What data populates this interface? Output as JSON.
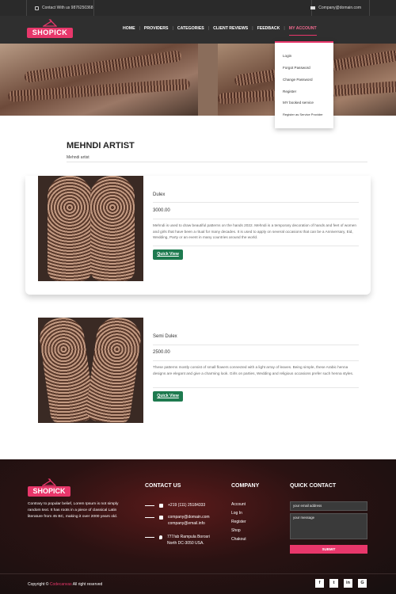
{
  "topbar": {
    "contact_text": "Contact With us 9876250368",
    "email_text": "Company@domain.com"
  },
  "brand": {
    "logo_text": "SHOPICK",
    "accent_color": "#e8376b"
  },
  "nav": {
    "items": [
      "HOME",
      "PROVIDERS",
      "CATEGORIES",
      "CLIENT REVIEWS",
      "FEEDBACK",
      "MY ACCOUNT"
    ],
    "active": "MY ACCOUNT"
  },
  "account_menu": {
    "items": [
      "Login",
      "Forgot Password",
      "Change Password",
      "Register",
      "MY booked service",
      "Register as Service Provider"
    ]
  },
  "page": {
    "title": "MEHNDI ARTIST",
    "breadcrumb": "Mehndi artist"
  },
  "products": [
    {
      "name": "Dulex",
      "price": "3000.00",
      "description": "Mehndi is used to draw beautiful patterns on the hands 2022. Mehndi is a temporary decoration of hands and feet of women and girls that have been a ritual for many decades. It is used to apply on several occasions that can be a Anniversary, Eid, Wedding, Party or an event in many countries around the world.",
      "button": "Quick View"
    },
    {
      "name": "Semi Dulex",
      "price": "2500.00",
      "description": "These patterns mostly consist of small flowers connected with a light array of leaves. Being simple, these Arabic henna designs are elegant and give a charming look. Girls on parties, Wedding and religious occasions prefer such henna styles.",
      "button": "Quick View"
    }
  ],
  "footer": {
    "about": "Contrary to popular belief, Lorem Ipsum is not simply random text. It has roots in a piece of classical Latin literature from 45 BC, making it over 2000 years old.",
    "contact_heading": "CONTACT US",
    "phone": "+219 (111) 25184333",
    "emails": [
      "company@domain.com",
      "company@email.info"
    ],
    "address": [
      "777/ab Rampula Borosri",
      "North DC-3050 USA."
    ],
    "company_heading": "COMPANY",
    "company_links": [
      "Account",
      "Log In",
      "Register",
      "Shop",
      "Chakout"
    ],
    "quick_heading": "QUICK CONTACT",
    "email_placeholder": "your email address",
    "message_placeholder": "your message",
    "submit_label": "SUBMIT",
    "copyright_prefix": "Copyright ©",
    "copyright_brand": "Codecanvas",
    "copyright_suffix": "All right reserved",
    "social": [
      "f",
      "t",
      "in",
      "G"
    ]
  }
}
